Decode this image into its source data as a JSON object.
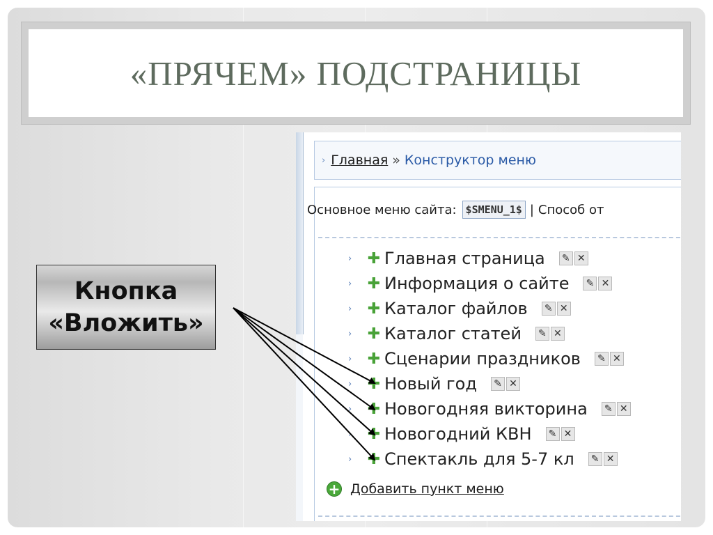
{
  "slide": {
    "title": "«ПРЯЧЕМ» ПОДСТРАНИЦЫ",
    "callout": {
      "line1": "Кнопка",
      "line2": "«Вложить»"
    }
  },
  "screenshot": {
    "breadcrumb": {
      "home": "Главная",
      "separator": "»",
      "current": "Конструктор меню"
    },
    "main_menu": {
      "label": "Основное меню сайта:",
      "variable": "$SMENU_1$",
      "divider": "|",
      "option": "Способ от"
    },
    "menu_items": [
      {
        "label": "Главная страница"
      },
      {
        "label": "Информация о сайте"
      },
      {
        "label": "Каталог файлов"
      },
      {
        "label": "Каталог статей"
      },
      {
        "label": "Сценарии праздников"
      },
      {
        "label": "Новый год"
      },
      {
        "label": "Новогодняя викторина"
      },
      {
        "label": "Новогодний КВН"
      },
      {
        "label": "Спектакль для 5-7 кл"
      }
    ],
    "add_item": "Добавить пункт меню"
  },
  "icons": {
    "expand": "chevron-right-icon",
    "nest": "plus-icon",
    "edit": "pencil-icon",
    "delete": "close-icon",
    "add": "add-circle-icon"
  },
  "colors": {
    "title": "#5e6b5e",
    "link_blue": "#2a5aa6",
    "plus_green": "#49a238"
  }
}
